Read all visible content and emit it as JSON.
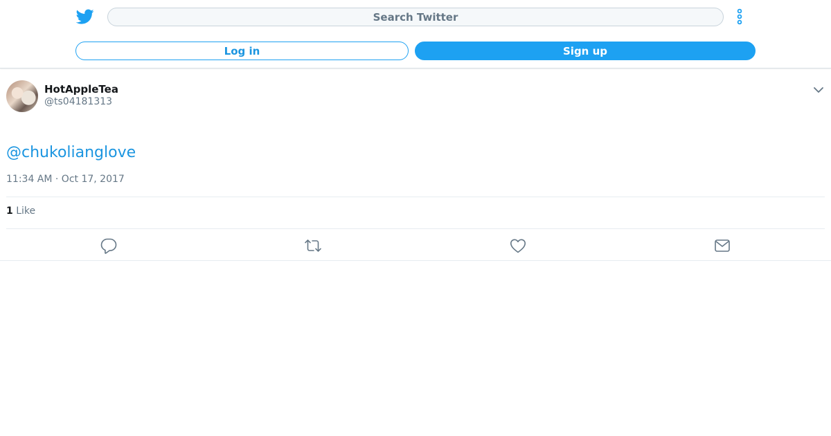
{
  "header": {
    "logo_icon": "twitter-bird-icon",
    "search_placeholder": "Search Twitter",
    "more_icon": "vertical-dots-icon",
    "login_label": "Log in",
    "signup_label": "Sign up",
    "accent_color": "#1da1f2"
  },
  "tweet": {
    "author_name": "HotAppleTea",
    "author_handle": "@ts04181313",
    "text": "@chukolianglove",
    "timestamp": "11:34 AM · Oct 17, 2017",
    "like_count": "1",
    "like_label": "Like",
    "actions": [
      "reply-icon",
      "retweet-icon",
      "like-icon",
      "message-icon"
    ]
  }
}
